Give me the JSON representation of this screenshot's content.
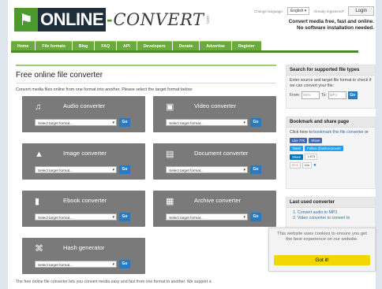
{
  "header": {
    "logo_online": "ONLINE",
    "logo_dash": "-",
    "logo_convert": "CONVERT",
    "logo_com": ".com",
    "change_language": "Change language:",
    "language": "English",
    "already_registered": "Already registered?",
    "login": "Login",
    "tagline_1": "Convert media free, fast and online.",
    "tagline_2": "No software installation needed."
  },
  "nav": {
    "items": [
      "Home",
      "File formats",
      "Blog",
      "FAQ",
      "API",
      "Developers",
      "Donate",
      "Advertise",
      "Register"
    ]
  },
  "main": {
    "title": "Free online file converter",
    "intro": "Convert media files online from one format into another. Please select the target format below:",
    "select_placeholder": "Select target format...",
    "go": "Go",
    "cards": [
      {
        "title": "Audio converter",
        "icon": "audio-icon"
      },
      {
        "title": "Video converter",
        "icon": "video-icon"
      },
      {
        "title": "Image converter",
        "icon": "image-icon"
      },
      {
        "title": "Document converter",
        "icon": "document-icon"
      },
      {
        "title": "Ebook converter",
        "icon": "ebook-icon"
      },
      {
        "title": "Archive converter",
        "icon": "archive-icon"
      },
      {
        "title": "Hash generator",
        "icon": "hash-icon"
      }
    ],
    "footer": "The free online file converter lets you convert media easy and fast from one format to another. We support a"
  },
  "sidebar": {
    "search": {
      "title": "Search for supported file types",
      "text": "Enter source and target file format to check if we can convert your file:",
      "from_label": "From:",
      "from_placeholder": "MOV",
      "to_label": "To:",
      "to_placeholder": "MP3",
      "go": "Go"
    },
    "bookmark": {
      "title": "Bookmark and share page",
      "text_prefix": "Click here to ",
      "text_link": "bookmark this file converter",
      "text_suffix": " or",
      "like": "Like 77K",
      "share": "Share",
      "tweet": "Tweet",
      "follow": "Follow @onlineconvert",
      "in_share": "Share",
      "count_in": "1,873",
      "plus": "G+1",
      "count_plus": "41k"
    },
    "recent": {
      "title": "Last used converter",
      "items": [
        "Convert audio to MP3",
        "Video converter to convert to"
      ]
    }
  },
  "cookie": {
    "text": "This website uses cookies to ensure you get the best experience on our website.",
    "button": "Got it!"
  },
  "colors": {
    "brand_green": "#6aaa3f",
    "card_grey": "#7a7a7a",
    "go_blue": "#2a7ac0",
    "cookie_yellow": "#f1d600"
  }
}
